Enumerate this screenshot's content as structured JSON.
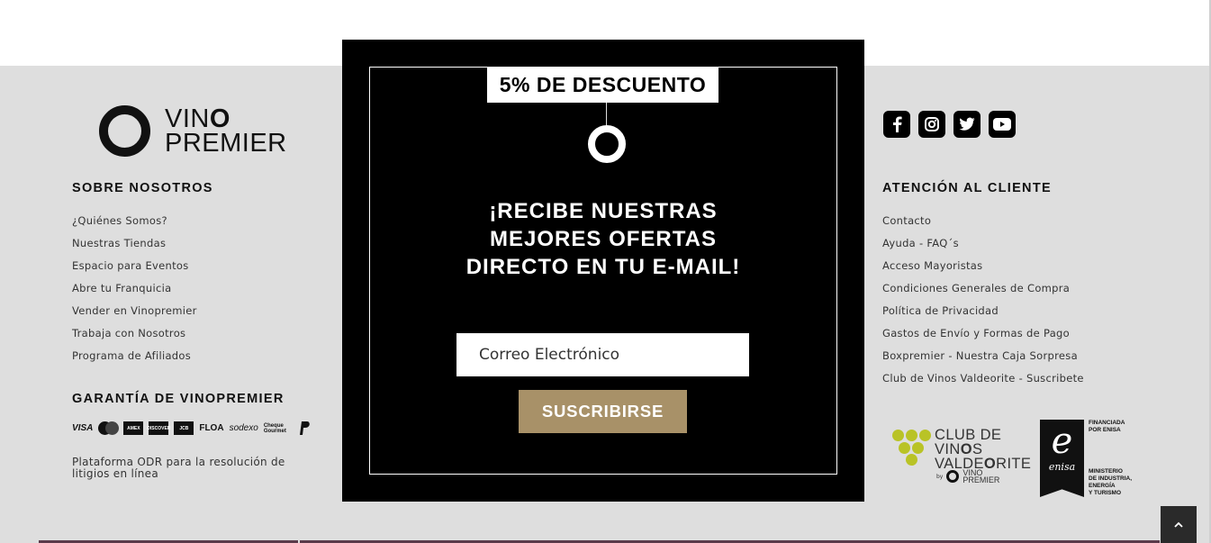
{
  "brand": {
    "line1": "VIN",
    "line1_bold": "O",
    "line2": "PREMIER"
  },
  "about": {
    "title": "SOBRE NOSOTROS",
    "links": [
      "¿Quiénes Somos?",
      "Nuestras Tiendas",
      "Espacio para Eventos",
      "Abre tu Franquicia",
      "Vender en Vinopremier",
      "Trabaja con Nosotros",
      "Programa de Afiliados"
    ]
  },
  "guarantee": {
    "title": "GARANTÍA DE VINOPREMIER",
    "payments": [
      "VISA",
      "AMEX",
      "DISCOVER",
      "JCB",
      "FLOA",
      "sodexo",
      "Cheque Gourmet",
      "PayPal"
    ],
    "odr": "Plataforma ODR para la resolución de litigios en línea"
  },
  "customer_service": {
    "title": "ATENCIÓN AL CLIENTE",
    "links": [
      "Contacto",
      "Ayuda - FAQ´s",
      "Acceso Mayoristas",
      "Condiciones Generales de Compra",
      "Política de Privacidad",
      "Gastos de Envío y Formas de Pago",
      "Boxpremier - Nuestra Caja Sorpresa",
      "Club de Vinos Valdeorite - Suscribete"
    ]
  },
  "social": [
    "facebook-icon",
    "instagram-icon",
    "twitter-icon",
    "youtube-icon"
  ],
  "club": {
    "line1": "CLUB DE",
    "line2a": "VIN",
    "line2b": "O",
    "line2c": "S",
    "line3a": "VALDE",
    "line3b": "O",
    "line3c": "RITE",
    "by": "by",
    "brand1": "VINO",
    "brand2": "PREMIER"
  },
  "enisa": {
    "letter": "e",
    "word": "enisa",
    "top1": "FINANCIADA",
    "top2": "POR ENISA",
    "m1": "MINISTERIO",
    "m2": "DE INDUSTRIA,",
    "m3": "ENERGÍA",
    "m4": "Y TURISMO"
  },
  "popup": {
    "discount": "5% DE DESCUENTO",
    "headline1": "¡RECIBE NUESTRAS",
    "headline2": "MEJORES OFERTAS",
    "headline3": "DIRECTO EN TU E-MAIL!",
    "email_placeholder": "Correo Electrónico",
    "subscribe": "SUSCRIBIRSE"
  },
  "colors": {
    "accent": "#a89168",
    "footer_bg": "#dedede",
    "club_green": "#b9c326"
  }
}
